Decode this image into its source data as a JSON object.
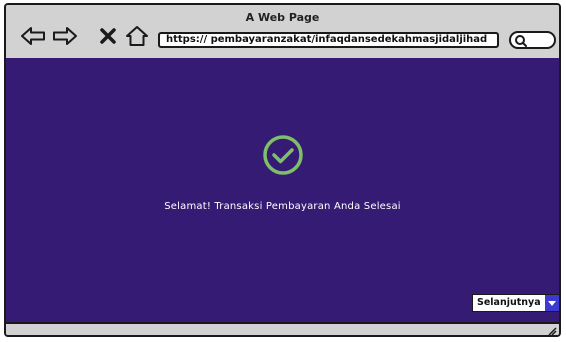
{
  "window": {
    "title": "A Web Page",
    "address_bar": {
      "url": "https:// pembayaranzakat/infaqdansedekahmasjidaljihad"
    },
    "nav_icons": [
      "back-arrow-icon",
      "forward-arrow-icon",
      "close-icon",
      "home-icon"
    ],
    "search_icon": "search-icon"
  },
  "content": {
    "background_color": "#351b73",
    "success_icon": "check-circle-icon",
    "success_icon_color": "#7fbf6a",
    "message": "Selamat! Transaksi Pembayaran Anda Selesai"
  },
  "next_dropdown": {
    "selected": "Selanjutnya",
    "arrow_color": "#3c3ad0"
  }
}
